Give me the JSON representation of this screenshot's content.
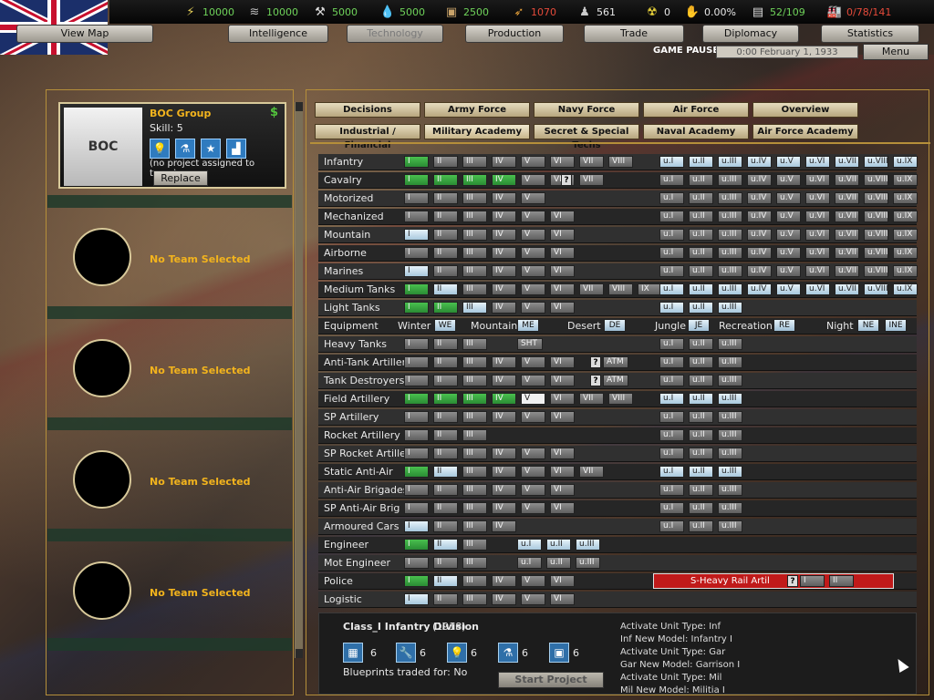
{
  "resources": [
    {
      "icon": "energy-icon",
      "value": "10000",
      "color": "#6fd35a"
    },
    {
      "icon": "metal-icon",
      "value": "10000",
      "color": "#6fd35a"
    },
    {
      "icon": "rare-materials-icon",
      "value": "5000",
      "color": "#6fd35a"
    },
    {
      "icon": "oil-icon",
      "value": "5000",
      "color": "#6fd35a"
    },
    {
      "icon": "supplies-icon",
      "value": "2500",
      "color": "#6fd35a"
    },
    {
      "icon": "money-icon",
      "value": "1070",
      "color": "#e64a3a"
    },
    {
      "icon": "manpower-icon",
      "value": "561",
      "color": "#e8e8e8"
    },
    {
      "icon": "nuke-icon",
      "value": "0",
      "color": "#e8e8e8"
    },
    {
      "icon": "dissent-icon",
      "value": "0.00%",
      "color": "#e8e8e8"
    },
    {
      "icon": "transport-icon",
      "value": "52/109",
      "color": "#6fd35a"
    },
    {
      "icon": "factory-icon",
      "value": "0/78/141",
      "color": "#e64a3a"
    }
  ],
  "nav": {
    "view_map": "View Map",
    "intelligence": "Intelligence",
    "technology": "Technology",
    "production": "Production",
    "trade": "Trade",
    "diplomacy": "Diplomacy",
    "statistics": "Statistics"
  },
  "status": {
    "paused": "GAME PAUSED",
    "date": "0:00 February 1, 1933",
    "menu": "Menu"
  },
  "team": {
    "name": "BOC Group",
    "skill": "Skill: 5",
    "logo_text": "BOC",
    "project": "(no project assigned to team)",
    "replace": "Replace"
  },
  "slots": {
    "empty": "No Team Selected"
  },
  "tabs": {
    "row1": [
      "Decisions",
      "Army Force",
      "Navy Force",
      "Air Force",
      "Overview"
    ],
    "row2": [
      "Industrial / Financial",
      "Military Academy",
      "Secret & Special Techs",
      "Naval Academy",
      "Air Force Academy"
    ]
  },
  "rows": [
    {
      "label": "Infantry"
    },
    {
      "label": "Cavalry"
    },
    {
      "label": "Motorized"
    },
    {
      "label": "Mechanized"
    },
    {
      "label": "Mountain"
    },
    {
      "label": "Airborne"
    },
    {
      "label": "Marines"
    },
    {
      "label": "Medium Tanks"
    },
    {
      "label": "Light Tanks"
    },
    {
      "label": "Equipment"
    },
    {
      "label": "Heavy Tanks"
    },
    {
      "label": "Anti-Tank Artillery"
    },
    {
      "label": "Tank Destroyers"
    },
    {
      "label": "Field Artillery"
    },
    {
      "label": "SP Artillery"
    },
    {
      "label": "Rocket Artillery"
    },
    {
      "label": "SP Rocket Artillery"
    },
    {
      "label": "Static Anti-Air"
    },
    {
      "label": "Anti-Air Brigades"
    },
    {
      "label": "SP Anti-Air Brig"
    },
    {
      "label": "Armoured Cars"
    },
    {
      "label": "Engineer"
    },
    {
      "label": "Mot Engineer"
    },
    {
      "label": "Police"
    },
    {
      "label": "Logistic"
    }
  ],
  "equipment": {
    "winter": "Winter",
    "we": "WE",
    "mountain": "Mountain",
    "me": "ME",
    "desert": "Desert",
    "de": "DE",
    "jungle": "Jungle",
    "je": "JE",
    "recreation": "Recreation",
    "re": "RE",
    "night": "Night",
    "ne": "NE",
    "ine": "INE"
  },
  "special": {
    "sht": "SHT",
    "atm": "ATM",
    "rail": "S-Heavy Rail Artil"
  },
  "info": {
    "title": "Class_I Infantry Division",
    "year": "(1918)",
    "bp": [
      "6",
      "6",
      "6",
      "6",
      "6"
    ],
    "traded": "Blueprints traded for: No",
    "start": "Start Project",
    "effects": [
      "Activate Unit Type: Inf",
      "Inf New Model: Infantry I",
      "Activate Unit Type: Gar",
      "Gar New Model: Garrison I",
      "Activate Unit Type: Mil",
      "Mil New Model: Militia I"
    ]
  }
}
